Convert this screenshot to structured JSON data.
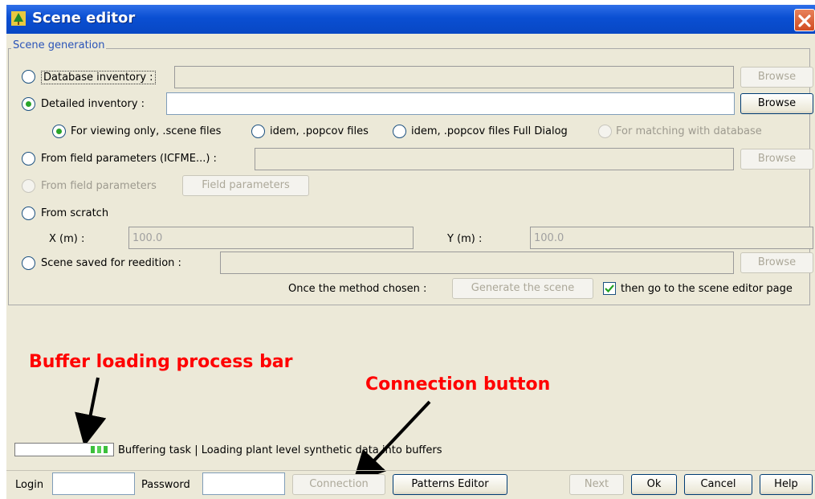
{
  "window": {
    "title": "Scene editor",
    "close_label": "X"
  },
  "group": {
    "legend": "Scene generation"
  },
  "database_inventory": {
    "label": "Database inventory :",
    "browse": "Browse"
  },
  "detailed_inventory": {
    "label": "Detailed inventory :",
    "browse": "Browse",
    "value": ""
  },
  "options": {
    "opt1": "For viewing only, .scene files",
    "opt2": "idem, .popcov files",
    "opt3": "idem, .popcov files Full Dialog",
    "opt4": "For matching with database"
  },
  "field_params": {
    "label": "From field parameters (ICFME...) :",
    "browse": "Browse"
  },
  "field_params2": {
    "label": "From field parameters",
    "button": "Field parameters"
  },
  "scratch": {
    "label": "From scratch",
    "x_label": "X (m) :",
    "x_value": "100.0",
    "y_label": "Y (m) :",
    "y_value": "100.0"
  },
  "saved": {
    "label": "Scene saved for reedition :",
    "browse": "Browse"
  },
  "generate": {
    "prompt": "Once the method chosen :",
    "button": "Generate the scene",
    "check_label": "then go to the scene editor page",
    "checked": true
  },
  "annotations": {
    "buffer": "Buffer loading process bar",
    "connection": "Connection button",
    "color": "#ff0000"
  },
  "status": {
    "text": "Buffering task  |  Loading plant level synthetic data into buffers"
  },
  "footer": {
    "login_label": "Login",
    "password_label": "Password",
    "connection": "Connection",
    "patterns": "Patterns Editor",
    "next": "Next",
    "ok": "Ok",
    "cancel": "Cancel",
    "help": "Help"
  }
}
